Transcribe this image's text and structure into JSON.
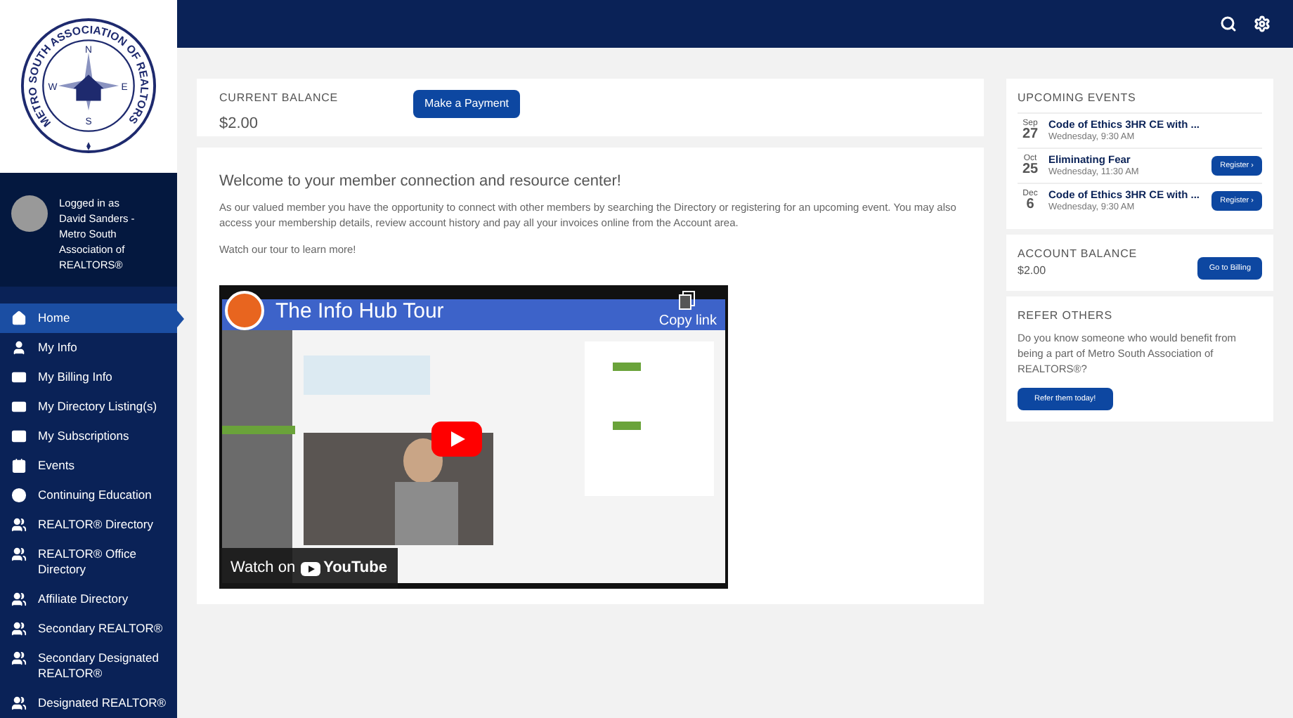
{
  "user": {
    "logged_in": "Logged in as David Sanders - Metro South Association of REALTORS®"
  },
  "logo": {
    "ring_text": "METRO SOUTH ASSOCIATION OF REALTORS",
    "compass": [
      "N",
      "E",
      "S",
      "W"
    ]
  },
  "sidebar": {
    "items": [
      {
        "label": "Home",
        "selected": true
      },
      {
        "label": "My Info",
        "selected": false
      },
      {
        "label": "My Billing Info",
        "selected": false
      },
      {
        "label": "My Directory Listing(s)",
        "selected": false
      },
      {
        "label": "My Subscriptions",
        "selected": false
      },
      {
        "label": "Events",
        "selected": false
      },
      {
        "label": "Continuing Education",
        "selected": false
      },
      {
        "label": "REALTOR® Directory",
        "selected": false
      },
      {
        "label": "REALTOR® Office Directory",
        "selected": false
      },
      {
        "label": "Affiliate Directory",
        "selected": false
      },
      {
        "label": "Secondary REALTOR®",
        "selected": false
      },
      {
        "label": "Secondary Designated REALTOR®",
        "selected": false
      },
      {
        "label": "Designated REALTOR®",
        "selected": false
      }
    ]
  },
  "balance": {
    "label": "CURRENT BALANCE",
    "amount": "$2.00",
    "button": "Make a Payment"
  },
  "welcome": {
    "title": "Welcome to your member connection and resource center!",
    "body": "As our valued member you have the opportunity to connect with other members by searching the Directory or registering for an upcoming event. You may also access your membership details, review account history and pay all your invoices online from the Account area.",
    "note": "Watch our tour to learn more!",
    "video": {
      "title": "The Info Hub Tour",
      "copy_link": "Copy link",
      "watch_on": "Watch on",
      "brand": "YouTube"
    }
  },
  "upcoming_events": {
    "title": "UPCOMING EVENTS",
    "events": [
      {
        "month": "Sep",
        "day": "27",
        "name": "Code of Ethics 3HR CE with ...",
        "when": "Wednesday, 9:30 AM"
      },
      {
        "month": "Oct",
        "day": "25",
        "name": "Eliminating Fear",
        "when": "Wednesday, 11:30 AM",
        "button": "Register ›"
      },
      {
        "month": "Dec",
        "day": "6",
        "name": "Code of Ethics 3HR CE with ...",
        "when": "Wednesday, 9:30 AM",
        "button": "Register ›"
      }
    ]
  },
  "account_balance": {
    "title": "ACCOUNT BALANCE",
    "amount": "$2.00",
    "button": "Go to Billing"
  },
  "refer": {
    "title": "REFER OTHERS",
    "text": "Do you know someone who would benefit from being a part of Metro South Association of REALTORS®?",
    "button": "Refer them today!"
  }
}
